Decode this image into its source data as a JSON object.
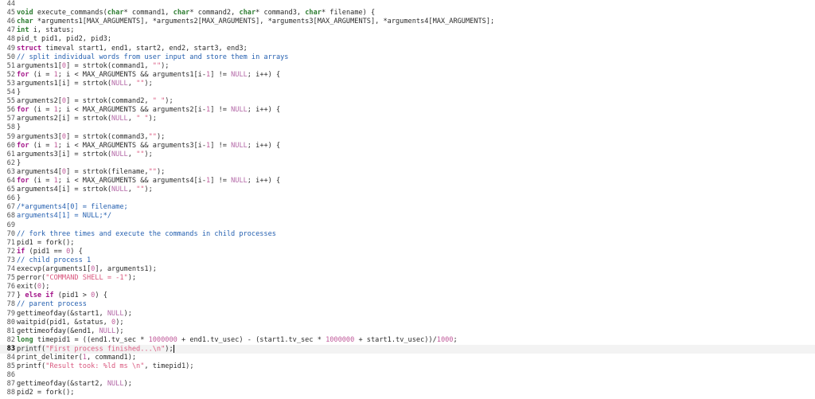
{
  "editor": {
    "current_line": 83,
    "lines": [
      {
        "n": "44",
        "t": [
          [
            "",
            ""
          ]
        ]
      },
      {
        "n": "45",
        "t": [
          [
            "ty",
            "void"
          ],
          [
            "",
            " execute_commands("
          ],
          [
            "ty",
            "char"
          ],
          [
            "",
            "* command1, "
          ],
          [
            "ty",
            "char"
          ],
          [
            "",
            "* command2, "
          ],
          [
            "ty",
            "char"
          ],
          [
            "",
            "* command3, "
          ],
          [
            "ty",
            "char"
          ],
          [
            "",
            "* filename) {"
          ]
        ]
      },
      {
        "n": "46",
        "t": [
          [
            "ty",
            "char"
          ],
          [
            "",
            " *arguments1[MAX_ARGUMENTS], *arguments2[MAX_ARGUMENTS], *arguments3[MAX_ARGUMENTS], *arguments4[MAX_ARGUMENTS];"
          ]
        ]
      },
      {
        "n": "47",
        "t": [
          [
            "ty",
            "int"
          ],
          [
            "",
            " i, status;"
          ]
        ]
      },
      {
        "n": "48",
        "t": [
          [
            "",
            "pid_t pid1, pid2, pid3;"
          ]
        ]
      },
      {
        "n": "49",
        "t": [
          [
            "kw",
            "struct"
          ],
          [
            "",
            " timeval start1, end1, start2, end2, start3, end3;"
          ]
        ]
      },
      {
        "n": "50",
        "t": [
          [
            "cmt",
            "// split individual words from user input and store them in arrays"
          ]
        ]
      },
      {
        "n": "51",
        "t": [
          [
            "",
            "arguments1["
          ],
          [
            "num",
            "0"
          ],
          [
            "",
            "] = strtok(command1, "
          ],
          [
            "str",
            "\"\""
          ],
          [
            "",
            ");"
          ]
        ]
      },
      {
        "n": "52",
        "t": [
          [
            "kw",
            "for"
          ],
          [
            "",
            " (i = "
          ],
          [
            "num",
            "1"
          ],
          [
            "",
            "; i < MAX_ARGUMENTS && arguments1[i-"
          ],
          [
            "num",
            "1"
          ],
          [
            "",
            "] != "
          ],
          [
            "lit",
            "NULL"
          ],
          [
            "",
            "; i++) {"
          ]
        ]
      },
      {
        "n": "53",
        "t": [
          [
            "",
            "arguments1[i] = strtok("
          ],
          [
            "lit",
            "NULL"
          ],
          [
            "",
            ", "
          ],
          [
            "str",
            "\"\""
          ],
          [
            "",
            ");"
          ]
        ]
      },
      {
        "n": "54",
        "t": [
          [
            "",
            "}"
          ]
        ]
      },
      {
        "n": "55",
        "t": [
          [
            "",
            "arguments2["
          ],
          [
            "num",
            "0"
          ],
          [
            "",
            "] = strtok(command2, "
          ],
          [
            "str",
            "\" \""
          ],
          [
            "",
            ");"
          ]
        ]
      },
      {
        "n": "56",
        "t": [
          [
            "kw",
            "for"
          ],
          [
            "",
            " (i = "
          ],
          [
            "num",
            "1"
          ],
          [
            "",
            "; i < MAX_ARGUMENTS && arguments2[i-"
          ],
          [
            "num",
            "1"
          ],
          [
            "",
            "] != "
          ],
          [
            "lit",
            "NULL"
          ],
          [
            "",
            "; i++) {"
          ]
        ]
      },
      {
        "n": "57",
        "t": [
          [
            "",
            "arguments2[i] = strtok("
          ],
          [
            "lit",
            "NULL"
          ],
          [
            "",
            ", "
          ],
          [
            "str",
            "\" \""
          ],
          [
            "",
            ");"
          ]
        ]
      },
      {
        "n": "58",
        "t": [
          [
            "",
            "}"
          ]
        ]
      },
      {
        "n": "59",
        "t": [
          [
            "",
            "arguments3["
          ],
          [
            "num",
            "0"
          ],
          [
            "",
            "] = strtok(command3,"
          ],
          [
            "str",
            "\"\""
          ],
          [
            "",
            ");"
          ]
        ]
      },
      {
        "n": "60",
        "t": [
          [
            "kw",
            "for"
          ],
          [
            "",
            " (i = "
          ],
          [
            "num",
            "1"
          ],
          [
            "",
            "; i < MAX_ARGUMENTS && arguments3[i-"
          ],
          [
            "num",
            "1"
          ],
          [
            "",
            "] != "
          ],
          [
            "lit",
            "NULL"
          ],
          [
            "",
            "; i++) {"
          ]
        ]
      },
      {
        "n": "61",
        "t": [
          [
            "",
            "arguments3[i] = strtok("
          ],
          [
            "lit",
            "NULL"
          ],
          [
            "",
            ", "
          ],
          [
            "str",
            "\"\""
          ],
          [
            "",
            ");"
          ]
        ]
      },
      {
        "n": "62",
        "t": [
          [
            "",
            "}"
          ]
        ]
      },
      {
        "n": "63",
        "t": [
          [
            "",
            "arguments4["
          ],
          [
            "num",
            "0"
          ],
          [
            "",
            "] = strtok(filename,"
          ],
          [
            "str",
            "\"\""
          ],
          [
            "",
            ");"
          ]
        ]
      },
      {
        "n": "64",
        "t": [
          [
            "kw",
            "for"
          ],
          [
            "",
            " (i = "
          ],
          [
            "num",
            "1"
          ],
          [
            "",
            "; i < MAX_ARGUMENTS && arguments4[i-"
          ],
          [
            "num",
            "1"
          ],
          [
            "",
            "] != "
          ],
          [
            "lit",
            "NULL"
          ],
          [
            "",
            "; i++) {"
          ]
        ]
      },
      {
        "n": "65",
        "t": [
          [
            "",
            "arguments4[i] = strtok("
          ],
          [
            "lit",
            "NULL"
          ],
          [
            "",
            ", "
          ],
          [
            "str",
            "\"\""
          ],
          [
            "",
            ");"
          ]
        ]
      },
      {
        "n": "66",
        "t": [
          [
            "",
            "}"
          ]
        ]
      },
      {
        "n": "67",
        "t": [
          [
            "cmt",
            "/*arguments4[0] = filename;"
          ]
        ]
      },
      {
        "n": "68",
        "t": [
          [
            "cmt",
            "arguments4[1] = NULL;*/"
          ]
        ]
      },
      {
        "n": "69",
        "t": [
          [
            "",
            ""
          ]
        ]
      },
      {
        "n": "70",
        "t": [
          [
            "cmt",
            "// fork three times and execute the commands in child processes"
          ]
        ]
      },
      {
        "n": "71",
        "t": [
          [
            "",
            "pid1 = fork();"
          ]
        ]
      },
      {
        "n": "72",
        "t": [
          [
            "kw",
            "if"
          ],
          [
            "",
            " (pid1 == "
          ],
          [
            "num",
            "0"
          ],
          [
            "",
            ") {"
          ]
        ]
      },
      {
        "n": "73",
        "t": [
          [
            "cmt",
            "// child process 1"
          ]
        ]
      },
      {
        "n": "74",
        "t": [
          [
            "",
            "execvp(arguments1["
          ],
          [
            "num",
            "0"
          ],
          [
            "",
            "], arguments1);"
          ]
        ]
      },
      {
        "n": "75",
        "t": [
          [
            "",
            "perror("
          ],
          [
            "str",
            "\"COMMAND SHELL = -1\""
          ],
          [
            "",
            ");"
          ]
        ]
      },
      {
        "n": "76",
        "t": [
          [
            "",
            "exit("
          ],
          [
            "num",
            "0"
          ],
          [
            "",
            ");"
          ]
        ]
      },
      {
        "n": "77",
        "t": [
          [
            "",
            "} "
          ],
          [
            "kw",
            "else if"
          ],
          [
            "",
            " (pid1 > "
          ],
          [
            "num",
            "0"
          ],
          [
            "",
            ") {"
          ]
        ]
      },
      {
        "n": "78",
        "t": [
          [
            "cmt",
            "// parent process"
          ]
        ]
      },
      {
        "n": "79",
        "t": [
          [
            "",
            "gettimeofday(&start1, "
          ],
          [
            "lit",
            "NULL"
          ],
          [
            "",
            ");"
          ]
        ]
      },
      {
        "n": "80",
        "t": [
          [
            "",
            "waitpid(pid1, &status, "
          ],
          [
            "num",
            "0"
          ],
          [
            "",
            ");"
          ]
        ]
      },
      {
        "n": "81",
        "t": [
          [
            "",
            "gettimeofday(&end1, "
          ],
          [
            "lit",
            "NULL"
          ],
          [
            "",
            ");"
          ]
        ]
      },
      {
        "n": "82",
        "t": [
          [
            "ty",
            "long"
          ],
          [
            "",
            " timepid1 = ((end1.tv_sec * "
          ],
          [
            "num",
            "1000000"
          ],
          [
            "",
            " + end1.tv_usec) - (start1.tv_sec * "
          ],
          [
            "num",
            "1000000"
          ],
          [
            "",
            " + start1.tv_usec))/"
          ],
          [
            "num",
            "1000"
          ],
          [
            "",
            ";"
          ]
        ]
      },
      {
        "n": "83",
        "t": [
          [
            "",
            "printf("
          ],
          [
            "str",
            "\"First process finished...\\n\""
          ],
          [
            "",
            ");"
          ]
        ]
      },
      {
        "n": "84",
        "t": [
          [
            "",
            "print_delimiter("
          ],
          [
            "num",
            "1"
          ],
          [
            "",
            ", command1);"
          ]
        ]
      },
      {
        "n": "85",
        "t": [
          [
            "",
            "printf("
          ],
          [
            "str",
            "\"Result took: %ld ms \\n\""
          ],
          [
            "",
            ", timepid1);"
          ]
        ]
      },
      {
        "n": "86",
        "t": [
          [
            "",
            ""
          ]
        ]
      },
      {
        "n": "87",
        "t": [
          [
            "",
            "gettimeofday(&start2, "
          ],
          [
            "lit",
            "NULL"
          ],
          [
            "",
            ");"
          ]
        ]
      },
      {
        "n": "88",
        "t": [
          [
            "",
            "pid2 = fork();"
          ]
        ]
      }
    ]
  }
}
